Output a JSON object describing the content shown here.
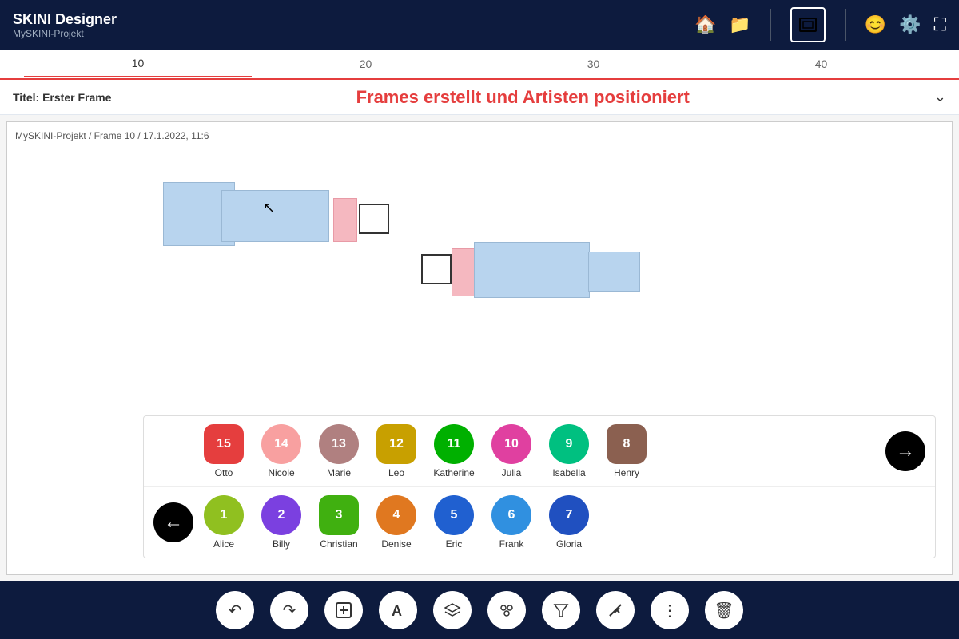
{
  "header": {
    "app_name": "SKINI Designer",
    "project_name": "MySKINI-Projekt",
    "icons": [
      "home",
      "folder",
      "square",
      "face",
      "settings",
      "fullscreen"
    ]
  },
  "timeline": {
    "items": [
      "10",
      "20",
      "30",
      "40"
    ],
    "active": "10"
  },
  "title_bar": {
    "label": "Titel:",
    "title": "Erster Frame",
    "comment": "Frames erstellt und Artisten positioniert"
  },
  "canvas": {
    "path": "MySKINI-Projekt / Frame 10 / 17.1.2022, 11:6"
  },
  "artists_page1": [
    {
      "id": 15,
      "name": "Otto",
      "color": "#e53e3e",
      "shape": "rounded-square"
    },
    {
      "id": 14,
      "name": "Nicole",
      "color": "#f8a0a0",
      "shape": "circle"
    },
    {
      "id": 13,
      "name": "Marie",
      "color": "#b08080",
      "shape": "circle"
    },
    {
      "id": 12,
      "name": "Leo",
      "color": "#c8a000",
      "shape": "rounded-square"
    },
    {
      "id": 11,
      "name": "Katherine",
      "color": "#00b000",
      "shape": "circle"
    },
    {
      "id": 10,
      "name": "Julia",
      "color": "#e040a0",
      "shape": "circle"
    },
    {
      "id": 9,
      "name": "Isabella",
      "color": "#00c080",
      "shape": "circle"
    },
    {
      "id": 8,
      "name": "Henry",
      "color": "#8b6050",
      "shape": "rounded-square"
    }
  ],
  "artists_page2": [
    {
      "id": 1,
      "name": "Alice",
      "color": "#90c020",
      "shape": "circle"
    },
    {
      "id": 2,
      "name": "Billy",
      "color": "#7b40e0",
      "shape": "circle"
    },
    {
      "id": 3,
      "name": "Christian",
      "color": "#40b010",
      "shape": "rounded-square"
    },
    {
      "id": 4,
      "name": "Denise",
      "color": "#e07820",
      "shape": "circle"
    },
    {
      "id": 5,
      "name": "Eric",
      "color": "#2060d0",
      "shape": "circle"
    },
    {
      "id": 6,
      "name": "Frank",
      "color": "#3090e0",
      "shape": "circle"
    },
    {
      "id": 7,
      "name": "Gloria",
      "color": "#2050c0",
      "shape": "circle"
    }
  ],
  "toolbar": {
    "buttons": [
      "undo",
      "redo",
      "add-frame",
      "text",
      "layers",
      "group",
      "filter",
      "tools",
      "more",
      "delete"
    ]
  }
}
